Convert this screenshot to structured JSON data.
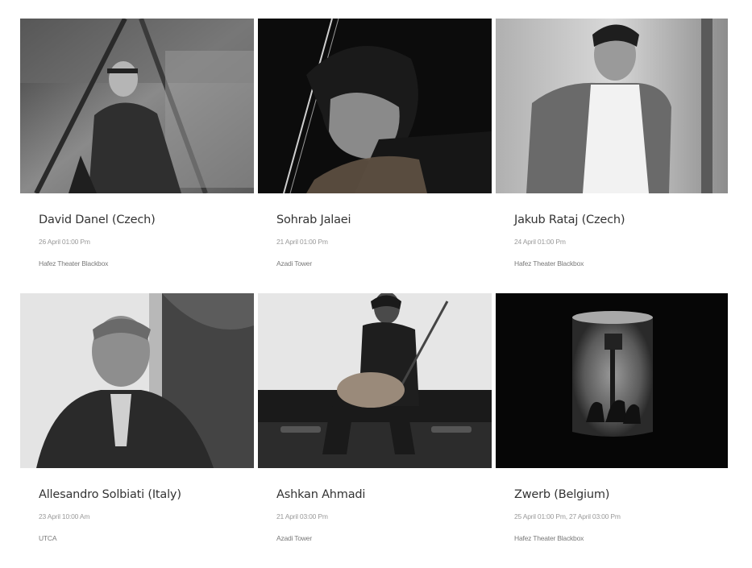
{
  "events": [
    {
      "name": "David Danel (Czech)",
      "date": "26 April 01:00 Pm",
      "venue": "Hafez Theater Blackbox",
      "photo_icon": "portrait-photo"
    },
    {
      "name": "Sohrab Jalaei",
      "date": "21 April 01:00 Pm",
      "venue": "Azadi Tower",
      "photo_icon": "violinist-photo"
    },
    {
      "name": "Jakub Rataj (Czech)",
      "date": "24 April 01:00 Pm",
      "venue": "Hafez Theater Blackbox",
      "photo_icon": "portrait-photo"
    },
    {
      "name": "Allesandro Solbiati (Italy)",
      "date": "23 April 10:00 Am",
      "venue": "UTCA",
      "photo_icon": "portrait-photo"
    },
    {
      "name": "Ashkan Ahmadi",
      "date": "21 April 03:00 Pm",
      "venue": "Azadi Tower",
      "photo_icon": "guitarist-photo"
    },
    {
      "name": "Zwerb (Belgium)",
      "date": "25 April 01:00 Pm, 27 April 03:00 Pm",
      "venue": "Hafez Theater Blackbox",
      "photo_icon": "stage-photo"
    }
  ],
  "colors": {
    "name_text": "#333333",
    "date_text": "#9a9a9a",
    "venue_text": "#7a7a7a",
    "background": "#ffffff"
  }
}
